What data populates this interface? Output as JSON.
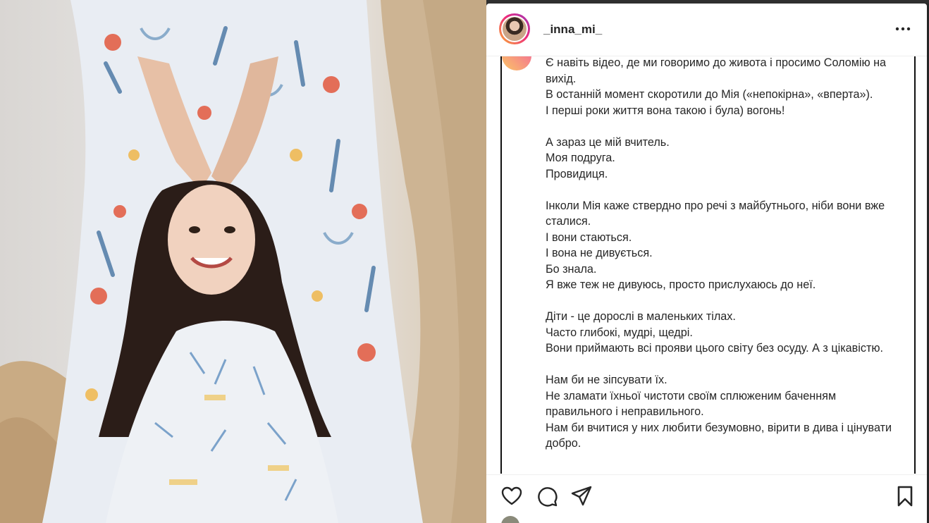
{
  "post": {
    "username": "_inna_mi_",
    "caption_lines": [
      "Є навіть відео, де ми говоримо до живота і просимо Соломію на вихід.",
      "В останній момент скоротили до Мія («непокірна», «вперта»).",
      "І перші роки життя вона такою і була) вогонь!",
      "",
      "А зараз це мій вчитель.",
      "Моя подруга.",
      "Провидиця.",
      "",
      "Інколи Мія каже ствердно про речі з майбутнього, ніби вони вже сталися.",
      "І вони стаються.",
      "І вона не дивується.",
      "Бо знала.",
      "Я вже теж не дивуюсь, просто прислухаюсь до неї.",
      "",
      "Діти - це дорослі в маленьких тілах.",
      "Часто глибокі, мудрі, щедрі.",
      "Вони приймають всі прояви цього світу без осуду. А з цікавістю.",
      "",
      "Нам би не зіпсувати їх.",
      "Не зламати їхньої чистоти своїм сплюженим баченням правильного і неправильного.",
      "Нам би вчитися у них любити безумовно, вірити в дива і цінувати добро."
    ]
  },
  "icons": {
    "more": "more-options-icon",
    "like": "heart-icon",
    "comment": "comment-icon",
    "share": "paper-plane-icon",
    "save": "bookmark-icon"
  },
  "colors": {
    "text": "#262626",
    "ring_start": "#f9b233",
    "ring_end": "#ee2a7b"
  }
}
